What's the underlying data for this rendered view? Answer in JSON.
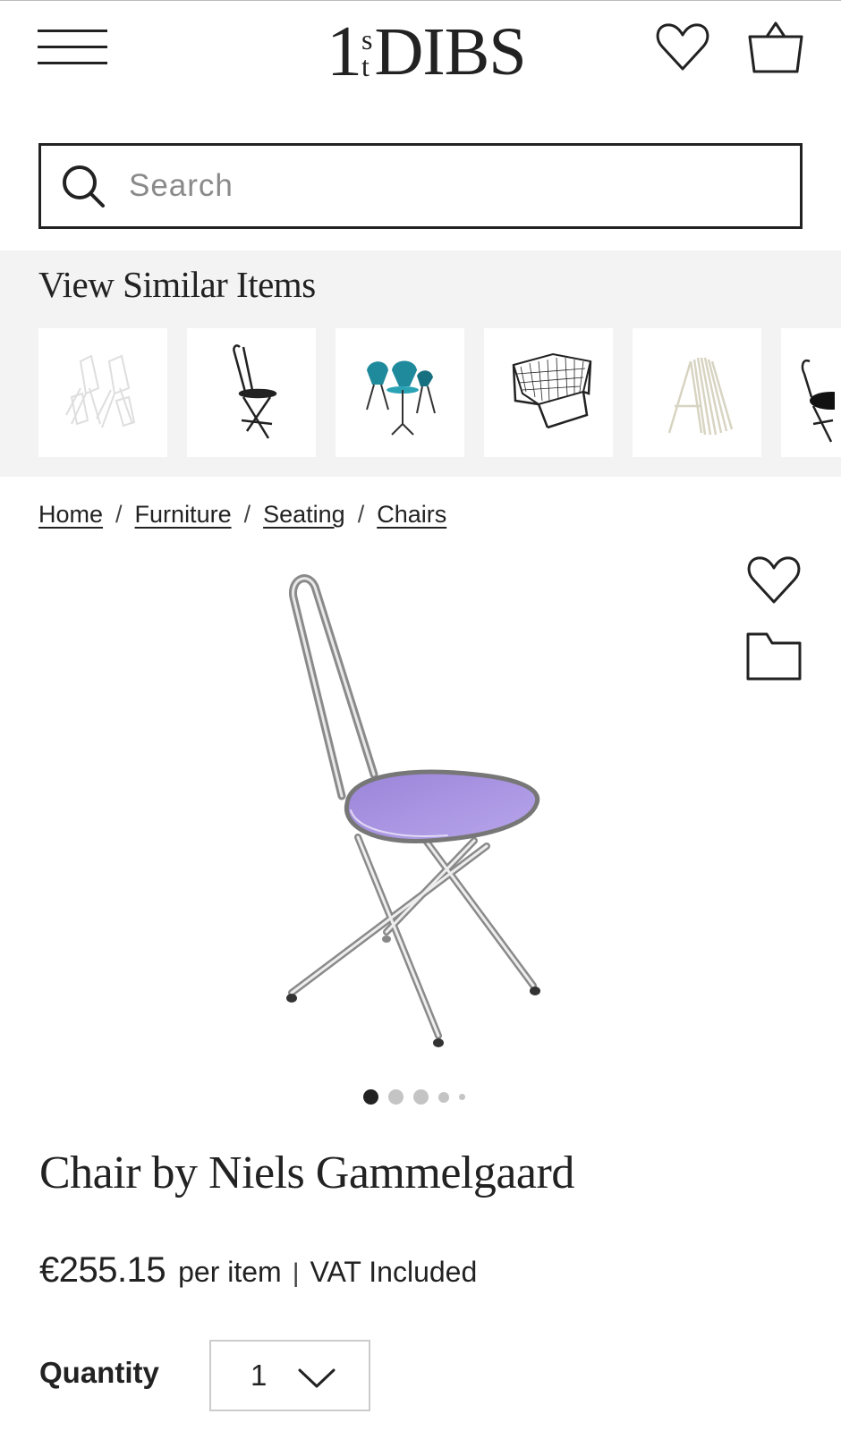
{
  "header": {
    "logo_number": "1",
    "logo_superscript_top": "s",
    "logo_superscript_bottom": "t",
    "logo_name": "DIBS",
    "menu_icon": "hamburger-menu-icon",
    "favorites_icon": "heart-icon",
    "cart_icon": "shopping-bag-icon"
  },
  "search": {
    "placeholder": "Search",
    "icon": "search-icon"
  },
  "similar": {
    "heading": "View Similar Items",
    "items": [
      {
        "kind": "white-folding-chairs",
        "color": "#e8e8e8"
      },
      {
        "kind": "black-folding-chair",
        "color": "#222222"
      },
      {
        "kind": "teal-bistro-set",
        "color": "#1f8a9c"
      },
      {
        "kind": "wire-lounge-chair",
        "color": "#333333"
      },
      {
        "kind": "stacked-cream-chairs",
        "color": "#e6e3d4"
      },
      {
        "kind": "black-seat-chair",
        "color": "#111111"
      }
    ]
  },
  "breadcrumb": {
    "items": [
      "Home",
      "Furniture",
      "Seating",
      "Chairs"
    ],
    "separator": "/"
  },
  "product": {
    "image": "chrome-frame-chair-with-purple-seat",
    "seat_color": "#a892e0",
    "save_icon": "heart-icon",
    "folder_icon": "folder-icon",
    "carousel": {
      "total": 5,
      "active": 1
    },
    "title": "Chair by Niels Gammelgaard",
    "price": "€255.15",
    "price_unit": "per item",
    "price_divider": "|",
    "vat_note": "VAT Included",
    "quantity_label": "Quantity",
    "quantity_value": "1"
  }
}
